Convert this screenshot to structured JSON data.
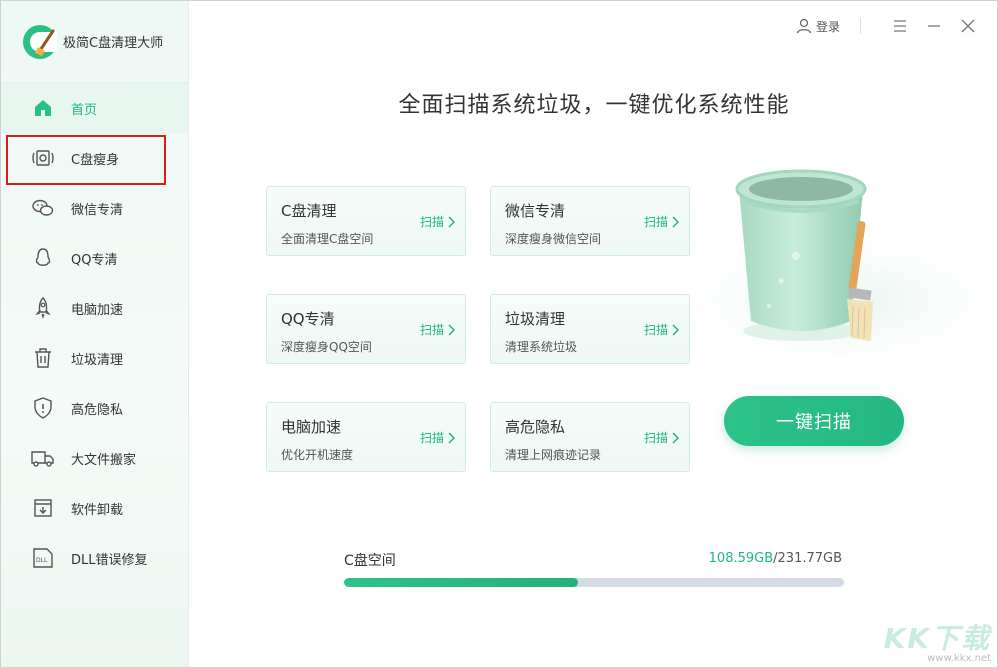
{
  "app": {
    "name": "极简C盘清理大师"
  },
  "topbar": {
    "login_label": "登录"
  },
  "sidebar": {
    "items": [
      {
        "label": "首页",
        "icon": "home-icon"
      },
      {
        "label": "C盘瘦身",
        "icon": "disk-slim-icon"
      },
      {
        "label": "微信专清",
        "icon": "wechat-icon"
      },
      {
        "label": "QQ专清",
        "icon": "qq-icon"
      },
      {
        "label": "电脑加速",
        "icon": "rocket-icon"
      },
      {
        "label": "垃圾清理",
        "icon": "trash-icon"
      },
      {
        "label": "高危隐私",
        "icon": "shield-icon"
      },
      {
        "label": "大文件搬家",
        "icon": "truck-icon"
      },
      {
        "label": "软件卸载",
        "icon": "uninstall-icon"
      },
      {
        "label": "DLL错误修复",
        "icon": "dll-icon"
      }
    ]
  },
  "main": {
    "headline": "全面扫描系统垃圾，一键优化系统性能",
    "scan_label": "扫描",
    "cards": [
      {
        "title": "C盘清理",
        "desc": "全面清理C盘空间"
      },
      {
        "title": "微信专清",
        "desc": "深度瘦身微信空间"
      },
      {
        "title": "QQ专清",
        "desc": "深度瘦身QQ空间"
      },
      {
        "title": "垃圾清理",
        "desc": "清理系统垃圾"
      },
      {
        "title": "电脑加速",
        "desc": "优化开机速度"
      },
      {
        "title": "高危隐私",
        "desc": "清理上网痕迹记录"
      }
    ],
    "one_click_label": "一键扫描",
    "disk": {
      "label": "C盘空间",
      "used": "108.59GB",
      "total": "/231.77GB",
      "used_fraction": 0.4685
    }
  },
  "watermark": {
    "big": "KK下载",
    "small": "www.kkx.net"
  },
  "colors": {
    "accent": "#1eb583",
    "highlight_border": "#d41e1e",
    "track": "#d5dbe3"
  }
}
